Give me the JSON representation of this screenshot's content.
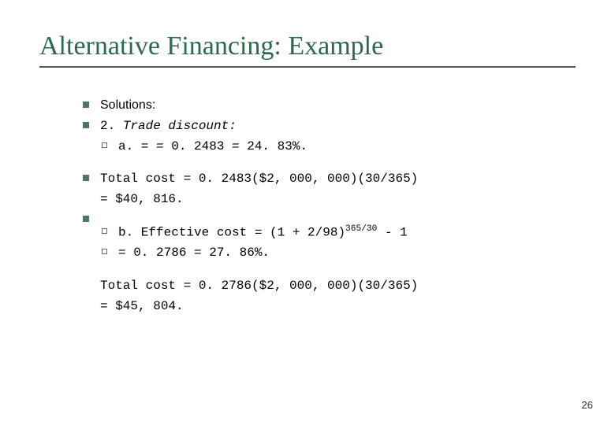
{
  "slide": {
    "title": "Alternative Financing: Example",
    "body": {
      "line1": "Solutions:",
      "line2a": "2.  ",
      "line2b": "Trade discount:",
      "line3": "a. =  = 0. 2483 = 24. 83%.",
      "line4": "Total cost = 0. 2483($2, 000, 000)(30/365)",
      "line5": "    = $40, 816.",
      "line6a": "b. Effective cost = (1 + 2/98)",
      "line6sup": "365/30",
      "line6b": " - 1",
      "line7": "  = 0. 2786 = 27. 86%.",
      "line8": "Total cost = 0. 2786($2, 000, 000)(30/365)",
      "line9": "    = $45, 804."
    },
    "page_number": "26"
  }
}
